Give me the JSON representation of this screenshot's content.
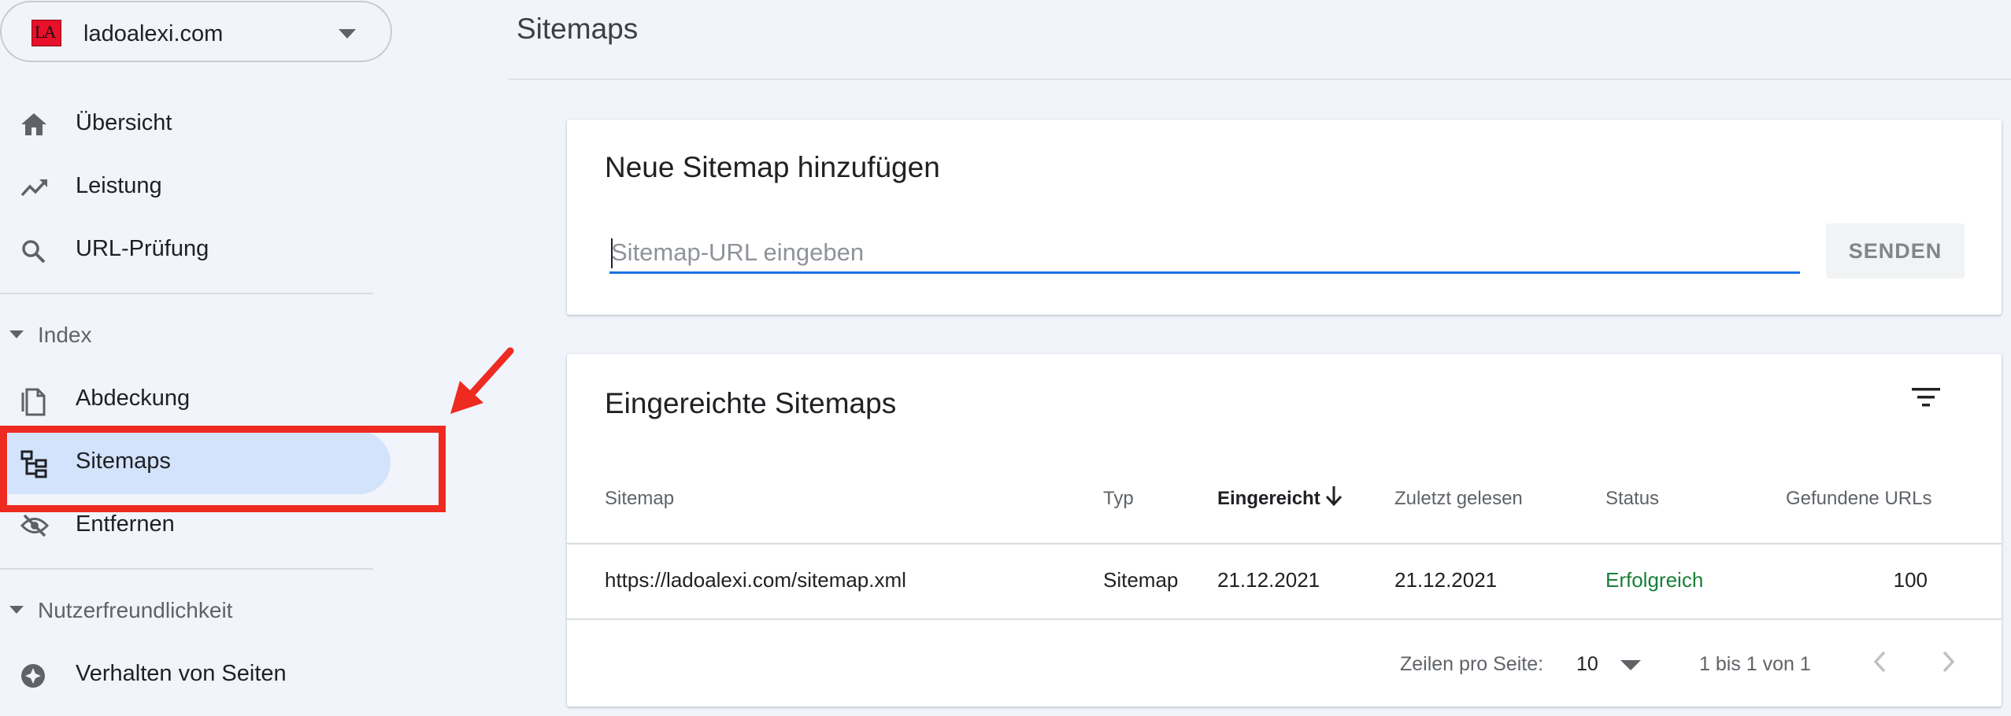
{
  "property": {
    "logo_text": "LA",
    "name": "ladoalexi.com"
  },
  "nav": {
    "overview": "Übersicht",
    "performance": "Leistung",
    "url_inspection": "URL-Prüfung",
    "index_section": "Index",
    "coverage": "Abdeckung",
    "sitemaps": "Sitemaps",
    "removals": "Entfernen",
    "ux_section": "Nutzerfreundlichkeit",
    "page_experience": "Verhalten von Seiten"
  },
  "page": {
    "title": "Sitemaps"
  },
  "add_sitemap": {
    "title": "Neue Sitemap hinzufügen",
    "placeholder": "Sitemap-URL eingeben",
    "value": "",
    "submit_label": "SENDEN"
  },
  "submitted": {
    "title": "Eingereichte Sitemaps",
    "headers": {
      "sitemap": "Sitemap",
      "type": "Typ",
      "submitted": "Eingereicht",
      "last_read": "Zuletzt gelesen",
      "status": "Status",
      "urls_found": "Gefundene URLs"
    },
    "rows": [
      {
        "sitemap": "https://ladoalexi.com/sitemap.xml",
        "type": "Sitemap",
        "submitted": "21.12.2021",
        "last_read": "21.12.2021",
        "status": "Erfolgreich",
        "urls_found": "100"
      }
    ],
    "pagination": {
      "rows_label": "Zeilen pro Seite:",
      "rows_value": "10",
      "range": "1 bis 1 von 1"
    }
  },
  "colors": {
    "accent": "#1a73e8",
    "active_nav": "#d3e3fc",
    "success": "#188038",
    "annotation": "#ee2b20"
  }
}
